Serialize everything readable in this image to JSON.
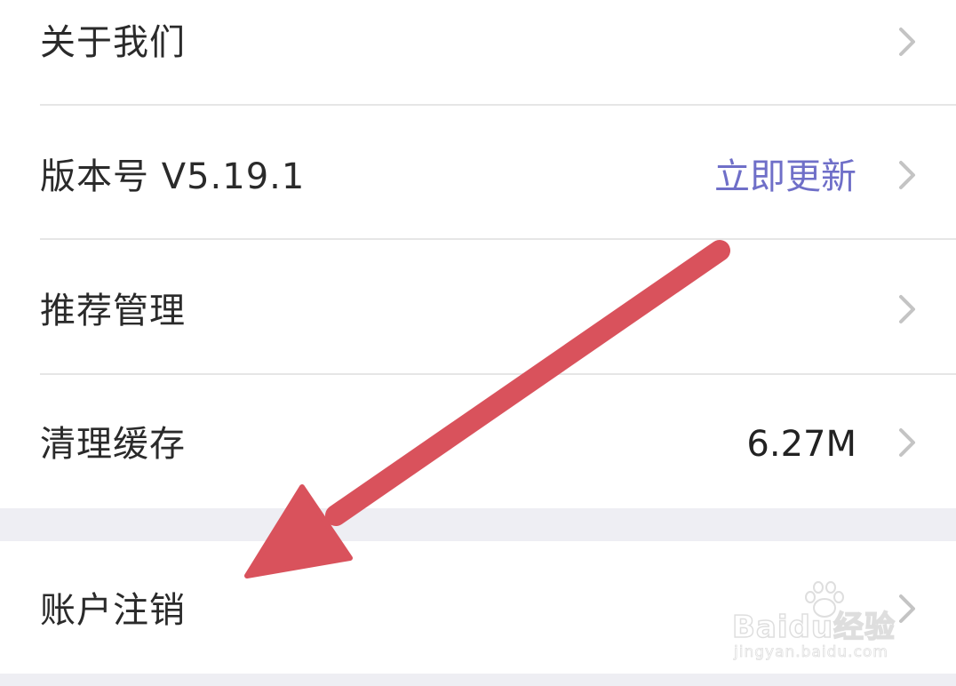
{
  "settings_list": {
    "items": [
      {
        "label": "关于我们",
        "value": ""
      },
      {
        "label": "版本号 V5.19.1",
        "value": "立即更新"
      },
      {
        "label": "推荐管理",
        "value": ""
      },
      {
        "label": "清理缓存",
        "value": "6.27M"
      }
    ],
    "account_section": {
      "items": [
        {
          "label": "账户注销"
        }
      ]
    }
  },
  "colors": {
    "update_link": "#6f6fc8",
    "annotation_arrow": "#d9525c",
    "section_gap": "#eeeef3",
    "chevron": "#c4c4c4"
  },
  "icons": {
    "chevron": "chevron-right-icon",
    "annotation": "arrow-annotation"
  },
  "watermark": {
    "logo": "Baidu经验",
    "url": "jingyan.baidu.com"
  }
}
